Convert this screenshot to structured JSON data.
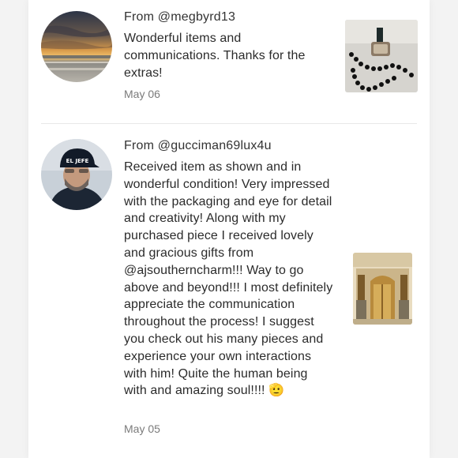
{
  "reviews": [
    {
      "from": "From @megbyrd13",
      "text": "Wonderful items and communications. Thanks for the extras!",
      "date": "May 06",
      "avatar_icon": "sunset-seascape-avatar",
      "thumb_icon": "black-bead-necklace-photo"
    },
    {
      "from": "From @gucciman69lux4u",
      "text": "Received item as shown and in wonderful condition! Very impressed with the packaging and eye for detail and creativity! Along with my purchased piece I received lovely and gracious gifts from @ajsoutherncharm!!! Way to go above and beyond!!! I most definitely appreciate the communication throughout the process! I suggest you check out his many pieces and experience your own interactions with him! Quite the human being with and amazing soul!!!! 🫡",
      "date": "May 05",
      "avatar_icon": "man-in-cap-avatar",
      "avatar_cap_text": "EL JEFE",
      "thumb_icon": "gucci-storefront-photo"
    }
  ],
  "colors": {
    "background": "#f3f3f3",
    "card": "#ffffff",
    "text": "#2b2b2b",
    "muted": "#7b7b7b",
    "divider": "#e8e8e8"
  }
}
